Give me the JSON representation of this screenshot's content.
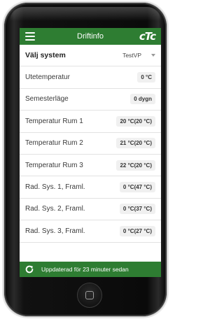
{
  "app": {
    "title": "Driftinfo",
    "logo": "cTc",
    "menu_icon": "hamburger-menu-icon",
    "accent_color": "#2e7d32"
  },
  "system": {
    "label": "Välj system",
    "selected": "TestVP"
  },
  "rows": [
    {
      "label": "Utetemperatur",
      "value": "0 °C"
    },
    {
      "label": "Semesterläge",
      "value": "0 dygn"
    },
    {
      "label": "Temperatur Rum 1",
      "value": "20 °C(20 °C)"
    },
    {
      "label": "Temperatur Rum 2",
      "value": "21 °C(20 °C)"
    },
    {
      "label": "Temperatur Rum 3",
      "value": "22 °C(20 °C)"
    },
    {
      "label": "Rad. Sys. 1, Framl.",
      "value": "0 °C(47 °C)"
    },
    {
      "label": "Rad. Sys. 2, Framl.",
      "value": "0 °C(37 °C)"
    },
    {
      "label": "Rad. Sys. 3, Framl.",
      "value": "0 °C(27 °C)"
    }
  ],
  "footer": {
    "icon": "refresh-icon",
    "text": "Uppdaterad för 23 minuter sedan"
  }
}
